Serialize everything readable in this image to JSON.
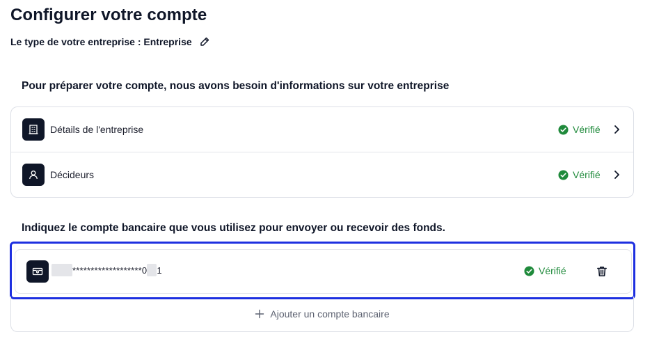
{
  "header": {
    "title": "Configurer votre compte",
    "business_type_label": "Le type de votre entreprise : Entreprise"
  },
  "company_section": {
    "title": "Pour préparer votre compte, nous avons besoin d'informations sur votre entreprise",
    "items": [
      {
        "label": "Détails de l'entreprise",
        "status": "Vérifié",
        "icon": "building-icon"
      },
      {
        "label": "Décideurs",
        "status": "Vérifié",
        "icon": "user-icon"
      }
    ]
  },
  "bank_section": {
    "title": "Indiquez le compte bancaire que vous utilisez pour envoyer ou recevoir des fonds.",
    "account": {
      "masked_number": "*******************0",
      "last_digit": "1",
      "status": "Vérifié",
      "icon": "bank-card-icon"
    },
    "add_label": "Ajouter un compte bancaire"
  },
  "colors": {
    "verified": "#1f8a3b",
    "highlight": "#1d2fe0",
    "tile": "#0f1628"
  }
}
